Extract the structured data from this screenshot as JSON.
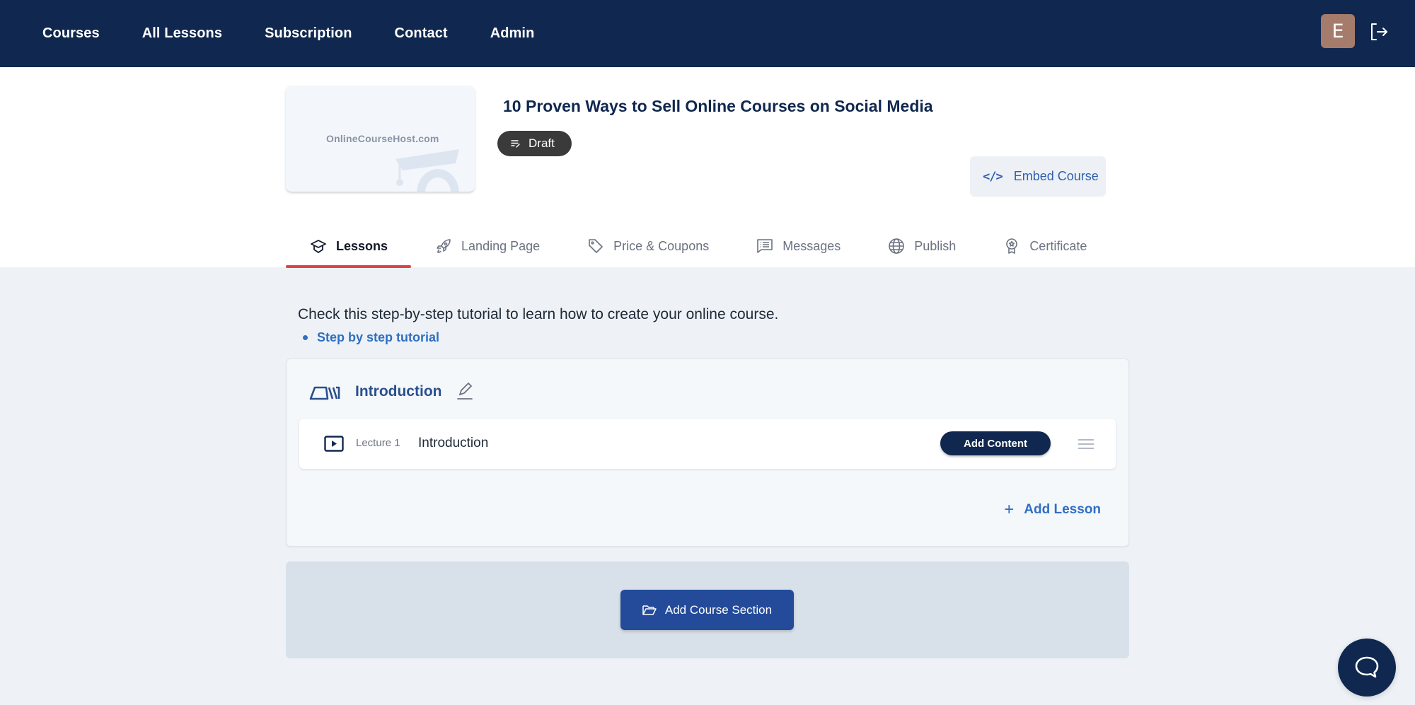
{
  "navbar": {
    "links": [
      "Courses",
      "All Lessons",
      "Subscription",
      "Contact",
      "Admin"
    ],
    "avatar_initial": "E",
    "logout_icon": "logout-icon",
    "background": "#10284f",
    "avatar_color": "#a57c6b"
  },
  "course": {
    "thumbnail_logo": "OnlineCourseHost.com",
    "title": "10 Proven Ways to Sell Online Courses on Social Media",
    "status": "Draft",
    "status_icon": "draft-list-edit-icon",
    "embed_label": "Embed Course",
    "embed_icon": "code-icon"
  },
  "tabs": [
    {
      "label": "Lessons",
      "icon": "graduation-cap-icon",
      "active": true
    },
    {
      "label": "Landing Page",
      "icon": "rocket-icon",
      "active": false
    },
    {
      "label": "Price & Coupons",
      "icon": "tag-icon",
      "active": false
    },
    {
      "label": "Messages",
      "icon": "message-icon",
      "active": false
    },
    {
      "label": "Publish",
      "icon": "globe-icon",
      "active": false
    },
    {
      "label": "Certificate",
      "icon": "award-icon",
      "active": false
    }
  ],
  "tab_active_color": "#dc4545",
  "intro": {
    "text": "Check this step-by-step tutorial to learn how to create your online course.",
    "link_label": "Step by step tutorial"
  },
  "sections": [
    {
      "title": "Introduction",
      "lectures": [
        {
          "number_label": "Lecture 1",
          "title": "Introduction",
          "action_label": "Add Content"
        }
      ],
      "add_lesson_label": "Add Lesson"
    }
  ],
  "add_section_label": "Add Course Section",
  "accent_color": "#2f6fc2",
  "chat_icon": "chat-icon"
}
